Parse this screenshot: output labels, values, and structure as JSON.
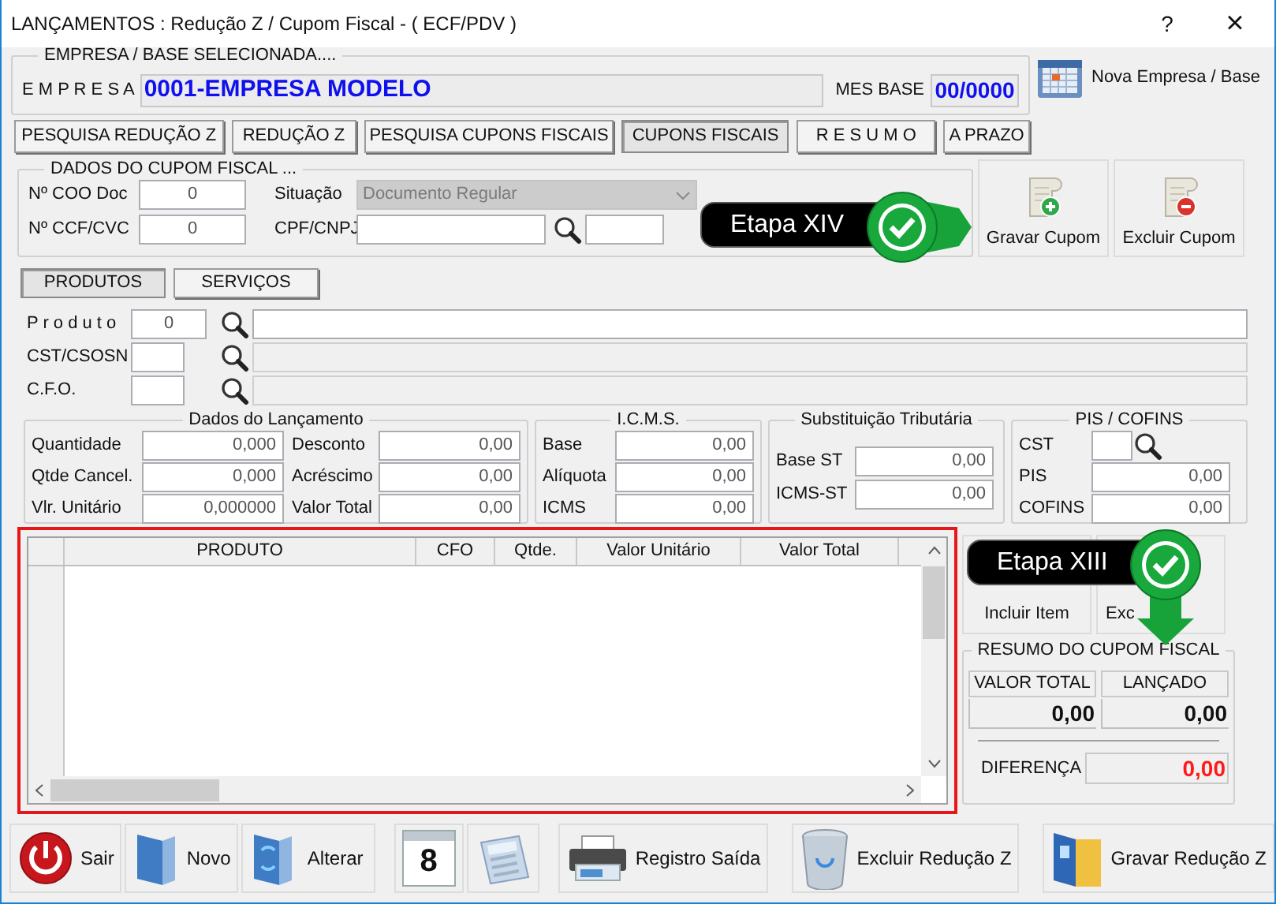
{
  "window": {
    "title": "LANÇAMENTOS : Redução Z / Cupom Fiscal - ( ECF/PDV )",
    "help": "?",
    "close": "×"
  },
  "empresa": {
    "legend": "EMPRESA / BASE SELECIONADA....",
    "label": "E M P R E S A",
    "value": "0001-EMPRESA MODELO",
    "mes_base_label": "MES BASE",
    "mes_base": "00/0000"
  },
  "nova_empresa_button": "Nova Empresa / Base",
  "tabs": [
    {
      "label": "PESQUISA REDUÇÃO Z",
      "selected": false
    },
    {
      "label": "REDUÇÃO Z",
      "selected": false
    },
    {
      "label": "PESQUISA CUPONS FISCAIS",
      "selected": false
    },
    {
      "label": "CUPONS FISCAIS",
      "selected": true
    },
    {
      "label": "R E S U M O",
      "selected": false
    },
    {
      "label": "A PRAZO",
      "selected": false
    }
  ],
  "cupom": {
    "legend": "DADOS DO CUPOM FISCAL ...",
    "fields": [
      {
        "label": "Nº COO Doc",
        "value": "0"
      },
      {
        "label": "Nº CCF/CVC",
        "value": "0"
      }
    ],
    "situacao_label": "Situação",
    "situacao": "Documento Regular",
    "situacao_disabled": true,
    "cpf_label": "CPF/CNPJ"
  },
  "cupom_buttons": [
    {
      "label": "Gravar Cupom",
      "kind": "add"
    },
    {
      "label": "Excluir Cupom",
      "kind": "remove"
    }
  ],
  "subtabs": [
    {
      "label": "PRODUTOS",
      "selected": true
    },
    {
      "label": "SERVIÇOS",
      "selected": false
    }
  ],
  "product_fields": [
    {
      "label": "P r o d u t o",
      "value": "0",
      "disabled": false
    },
    {
      "label": "CST/CSOSN",
      "disabled": true
    },
    {
      "label": "C.F.O.",
      "disabled": true
    }
  ],
  "groups": [
    {
      "title": "Dados do Lançamento",
      "kind": "two_column",
      "fields": [
        {
          "label": "Quantidade",
          "value": "0,000"
        },
        {
          "label": "Qtde Cancel.",
          "value": "0,000"
        },
        {
          "label": "Vlr. Unitário",
          "value": "0,000000"
        },
        {
          "label": "Desconto",
          "value": "0,00"
        },
        {
          "label": "Acréscimo",
          "value": "0,00"
        },
        {
          "label": "Valor Total",
          "value": "0,00"
        }
      ]
    },
    {
      "title": "I.C.M.S.",
      "kind": "column",
      "fields": [
        {
          "label": "Base",
          "value": "0,00"
        },
        {
          "label": "Alíquota",
          "value": "0,00"
        },
        {
          "label": "ICMS",
          "value": "0,00"
        }
      ]
    },
    {
      "title": "Substituição Tributária",
      "kind": "column_low",
      "fields": [
        {
          "label": "Base ST",
          "value": "0,00"
        },
        {
          "label": "ICMS-ST",
          "value": "0,00"
        }
      ]
    },
    {
      "title": "PIS / COFINS",
      "kind": "pis",
      "fields": [
        {
          "label": "CST"
        },
        {
          "label": "PIS",
          "value": "0,00"
        },
        {
          "label": "COFINS",
          "value": "0,00"
        }
      ]
    }
  ],
  "grid": {
    "columns": [
      "PRODUTO",
      "CFO",
      "Qtde.",
      "Valor Unitário",
      "Valor Total"
    ]
  },
  "item_buttons": [
    {
      "label": "Incluir Item"
    },
    {
      "label": "Exc"
    }
  ],
  "resumo": {
    "title": "RESUMO DO CUPOM FISCAL",
    "valor_total_label": "VALOR TOTAL",
    "lancado_label": "LANÇADO",
    "valor_total": "0,00",
    "lancado": "0,00",
    "diferenca_label": "DIFERENÇA",
    "diferenca": "0,00"
  },
  "callouts": [
    {
      "label": "Etapa XIV"
    },
    {
      "label": "Etapa XIII"
    }
  ],
  "toolbar": [
    {
      "label": "Sair",
      "kind": "power"
    },
    {
      "label": "Novo",
      "kind": "new"
    },
    {
      "label": "Alterar",
      "kind": "edit"
    },
    {
      "kind": "calendar",
      "day": "8"
    },
    {
      "kind": "calculator"
    },
    {
      "label": "Registro Saída",
      "kind": "printer"
    },
    {
      "label": "Excluir Redução Z",
      "kind": "trash"
    },
    {
      "label": "Gravar Redução Z",
      "kind": "folder"
    }
  ]
}
